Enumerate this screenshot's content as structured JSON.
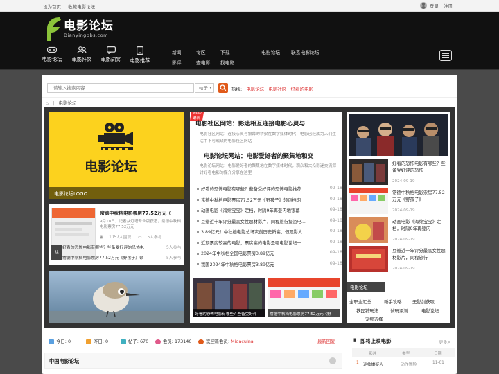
{
  "topbar": {
    "set_home": "设为首页",
    "bookmark": "收藏电影论坛",
    "login": "登录",
    "register": "注册"
  },
  "logo": {
    "title": "电影论坛",
    "subtitle": "Dianyingbbs.com"
  },
  "nav": {
    "main": [
      {
        "label": "电影论坛",
        "icon": "gamepad-icon"
      },
      {
        "label": "电影社区",
        "icon": "people-icon"
      },
      {
        "label": "电影问答",
        "icon": "chat-icon"
      },
      {
        "label": "电影推荐",
        "icon": "tablet-icon"
      }
    ],
    "sub": [
      "新闻",
      "专区",
      "下载",
      "影评",
      "查电影",
      "找电影"
    ],
    "extra": [
      "电影论坛",
      "联系电影论坛"
    ]
  },
  "search": {
    "placeholder": "请输入搜索内容",
    "select": "帖子",
    "hot_label": "热搜:",
    "hot": [
      "电影论坛",
      "电影社区",
      "好看的电影"
    ]
  },
  "breadcrumb": {
    "current": "电影论坛"
  },
  "featured": {
    "logo_text": "电影论坛",
    "caption": "电影论坛LOGO"
  },
  "card2": {
    "title": "常德中秋档电影票房77.52万元《",
    "desc": "9月18日，记者从灯塔专业版获悉，常德中秋档电影票房77.52万元",
    "views": "1057人围观",
    "joined": "5人参与",
    "rows": [
      {
        "text": "好看的恐怖电影有哪些？些备受好评的恐怖电",
        "count": "5人参与"
      },
      {
        "text": "常德中秋档电影票房77.52万元《野孩子》领",
        "count": "5人参与"
      }
    ]
  },
  "center": {
    "new_badge": "NEW 最新",
    "headline1": "电影社区网站：影迷相互连接电影心灵与",
    "para1": "电影社区网站：连接心灵与银幕的桥梁在数字媒体时代，电影已经成为人们生活中不可或缺的电影社区网站",
    "headline2": "电影论坛网站：电影爱好者的聚集地和交",
    "para2": "电影论坛网站：电影爱好者的聚集地在数字媒体时代，观众和大众影迷交流探讨好看电影的媒介分享在这里",
    "news": [
      {
        "text": "好看的恐怖电影有哪些？些备受好评的恐怖电影推荐",
        "date": "09-18"
      },
      {
        "text": "常德中秋档电影票房77.52万元《野孩子》领跑档期",
        "date": "09-18"
      },
      {
        "text": "动画电影《海绵宝宝》定档，时隔9年再登内地银幕",
        "date": "09-18"
      },
      {
        "text": "豆瓣近十年评分最高女性题材影片，同程旅行投资电...",
        "date": "09-18"
      },
      {
        "text": "3.89亿元！中秋档电影总场次创历史新高，但观影人...",
        "date": "09-18"
      },
      {
        "text": "近期票房较高的电影，票房高的电影是哪电影论坛一...",
        "date": "09-18"
      },
      {
        "text": "2024年中秋档全国电影票房3.89亿元",
        "date": "09-18"
      },
      {
        "text": "我国2024年中秋档电影票房3.89亿元",
        "date": "09-18"
      }
    ],
    "thumb_captions": [
      "好看的恐怖电影有哪些？些备受好评",
      "常德中秋档电影票房77.52万元《野"
    ]
  },
  "right": {
    "items": [
      {
        "text": "好看的恐怖电影有哪些？些备受好评的恐怖",
        "date": "2024-09-19"
      },
      {
        "text": "常德中秋档电影票房77.52万元《野孩子》",
        "date": "2024-09-19"
      },
      {
        "text": "动画电影《海绵宝宝》定档，时隔9年再登内",
        "date": "2024-09-19"
      },
      {
        "text": "豆瓣近十年评分最高女性题材影片，同程旅行",
        "date": "2024-09-19"
      }
    ],
    "box_title": "电影论坛",
    "tags": [
      "全职业汇总",
      "新手攻略",
      "无影剑获取",
      "铁匠铺玩法",
      "试玩评测",
      "电影论坛",
      "宠物选择"
    ]
  },
  "stats": {
    "today": "今日: 0",
    "yesterday": "昨日: 0",
    "posts": "帖子: 670",
    "members": "会员: 173146",
    "welcome_label": "欢迎新会员:",
    "new_member": "Midaculna",
    "latest": "最新回复"
  },
  "section": {
    "china_title": "中国电影论坛"
  },
  "upcoming": {
    "title": "即将上映电影",
    "more": "更多>",
    "headers": [
      "影片",
      "类型",
      "日期"
    ],
    "rows": [
      {
        "num": "1",
        "name": "迷妆嫌疑人",
        "type": "动作冒险",
        "date": "11-01"
      }
    ]
  },
  "colors": {
    "accent": "#e05a1a",
    "hot": "#dd3333",
    "dark": "#333333",
    "header": "#111111",
    "logo_green": "#8bc33a"
  }
}
